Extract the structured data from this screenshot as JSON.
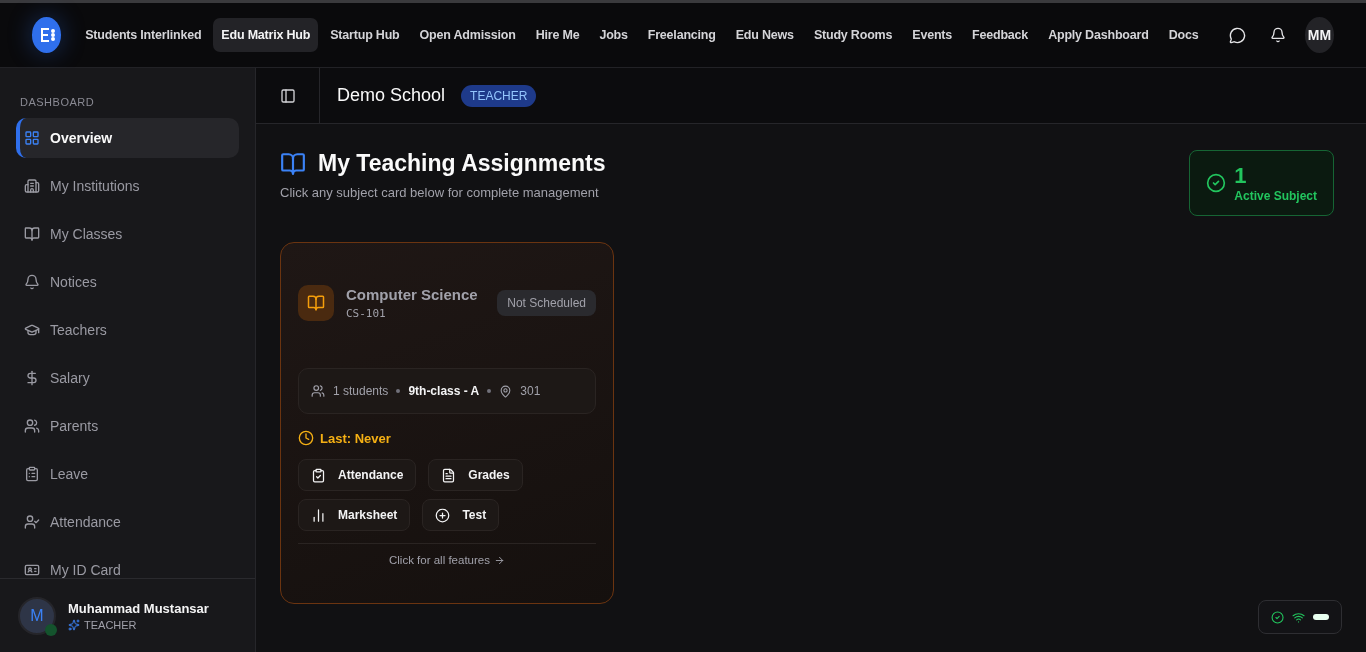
{
  "topbar": {
    "nav": [
      {
        "label": "Students Interlinked",
        "selected": false
      },
      {
        "label": "Edu Matrix Hub",
        "selected": true
      },
      {
        "label": "Startup Hub",
        "selected": false
      },
      {
        "label": "Open Admission",
        "selected": false
      },
      {
        "label": "Hire Me",
        "selected": false
      },
      {
        "label": "Jobs",
        "selected": false
      },
      {
        "label": "Freelancing",
        "selected": false
      },
      {
        "label": "Edu News",
        "selected": false
      },
      {
        "label": "Study Rooms",
        "selected": false
      },
      {
        "label": "Events",
        "selected": false
      },
      {
        "label": "Feedback",
        "selected": false
      },
      {
        "label": "Apply Dashboard",
        "selected": false
      },
      {
        "label": "Docs",
        "selected": false
      }
    ],
    "avatar": "MM"
  },
  "sidebar": {
    "section": "DASHBOARD",
    "items": [
      {
        "label": "Overview",
        "selected": true
      },
      {
        "label": "My Institutions",
        "selected": false
      },
      {
        "label": "My Classes",
        "selected": false
      },
      {
        "label": "Notices",
        "selected": false
      },
      {
        "label": "Teachers",
        "selected": false
      },
      {
        "label": "Salary",
        "selected": false
      },
      {
        "label": "Parents",
        "selected": false
      },
      {
        "label": "Leave",
        "selected": false
      },
      {
        "label": "Attendance",
        "selected": false
      },
      {
        "label": "My ID Card",
        "selected": false
      }
    ],
    "user": {
      "initial": "M",
      "name": "Muhammad Mustansar",
      "role": "TEACHER",
      "online": true
    }
  },
  "header": {
    "school": "Demo School",
    "role_badge": "TEACHER"
  },
  "page": {
    "title": "My Teaching Assignments",
    "subtitle": "Click any subject card below for complete management",
    "stat": {
      "value": "1",
      "label": "Active Subject"
    }
  },
  "subjects": [
    {
      "name": "Computer Science",
      "code": "CS-101",
      "status": "Not Scheduled",
      "students": "1 students",
      "class": "9th-class - A",
      "room": "301",
      "last": "Last: Never",
      "actions": [
        "Attendance",
        "Grades",
        "Marksheet",
        "Test"
      ],
      "footer": "Click for all features"
    }
  ]
}
